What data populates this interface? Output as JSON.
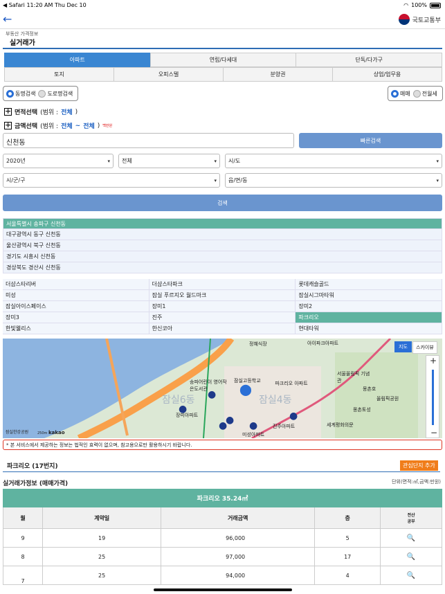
{
  "status": {
    "left": "◀ Safari   11:20 AM   Thu Dec 10",
    "battery": "100%"
  },
  "nav": {
    "back": "←",
    "logo_text": "국토교통부"
  },
  "breadcrumb": "부동산 가격정보",
  "page_title": "실거래가",
  "tabs_row1": [
    "아파트",
    "연립/다세대",
    "단독/다가구"
  ],
  "tabs_row2": [
    "토지",
    "오피스텔",
    "분양권",
    "상업/업무용"
  ],
  "search_type": {
    "option1": "동명검색",
    "option2": "도로명검색"
  },
  "deal_type": {
    "option1": "매매",
    "option2": "전월세"
  },
  "area": {
    "label": "면적선택",
    "range_prefix": "(범위 : ",
    "value": "전체",
    "suffix": ")"
  },
  "amount": {
    "label": "금액선택",
    "range_prefix": "(범위 : ",
    "from": "전체",
    "tilde": " ~ ",
    "to": "전체",
    "suffix": ")",
    "unit": "백만원"
  },
  "query": "신천동",
  "quick_search": "빠른검색",
  "dropdowns": {
    "year": "2020년",
    "period": "전체",
    "sido": "시/도",
    "sigungu": "시/군/구",
    "eupmyeon": "읍/면/동"
  },
  "search_button": "검색",
  "results": [
    "서울특별시 송파구 신천동",
    "대구광역시 동구 신천동",
    "울산광역시 북구 신천동",
    "경기도 시흥시 신천동",
    "경상북도 경산시 신천동"
  ],
  "complexes": [
    "더샵스타리버",
    "더샵스타파크",
    "롯데캐슬골드",
    "미성",
    "잠실 푸르지오 월드마크",
    "잠실시그마타워",
    "잠실아이스페이스",
    "장미1",
    "장미2",
    "장미3",
    "진주",
    "파크리오",
    "한빛웰리스",
    "한신코아",
    "현대타워"
  ],
  "map": {
    "btn_map": "지도",
    "btn_sky": "스카이뷰",
    "scale": "250m",
    "brand": "kakao",
    "labels": [
      "정혜식장",
      "파크리오 아파트",
      "잠실고등학교",
      "송파어린이 영어작은도서관",
      "잠실6동",
      "잠실4동",
      "진주아파트",
      "미성아파트",
      "서울올림픽 기념관",
      "올림픽공원",
      "세계평화의문",
      "장미아파트",
      "아이파크아파트",
      "몽촌토성",
      "몽촌호",
      "잠실한강공원"
    ]
  },
  "notice": "* 본 서비스에서 제공하는 정보는 법적인 효력이 없으며, 참고용으로만 활용하시기 바랍니다.",
  "complex_title": "파크리오 (17번지)",
  "fav_button": "관심단지 추가",
  "info_title": "실거래가정보 (매매가격)",
  "unit_info": "단위(면적:㎡,금액:만원)",
  "table": {
    "caption": "파크리오 35.24㎡",
    "headers": [
      "월",
      "계약일",
      "거래금액",
      "층",
      "전산\n공부"
    ],
    "rows": [
      {
        "month": "9",
        "day": "19",
        "price": "96,000",
        "floor": "5"
      },
      {
        "month": "8",
        "day": "25",
        "price": "97,000",
        "floor": "17"
      },
      {
        "month": "7",
        "day": "25",
        "price": "94,000",
        "floor": "4"
      }
    ]
  }
}
